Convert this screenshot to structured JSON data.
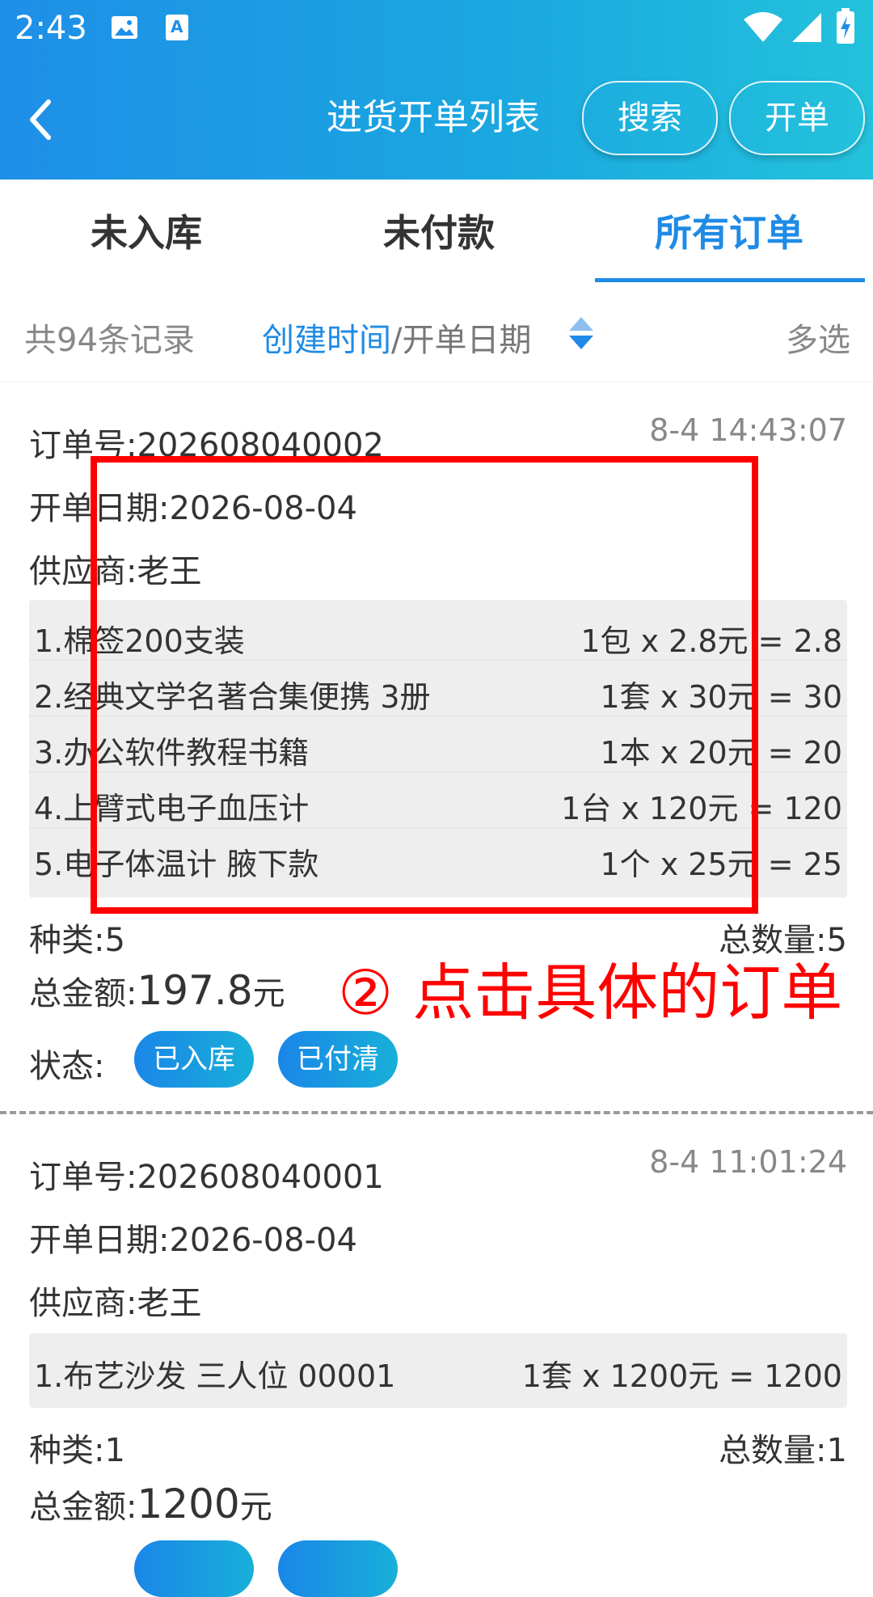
{
  "status_bar": {
    "time": "2:43",
    "icons": [
      "image-icon",
      "text-a-icon",
      "wifi-icon",
      "signal-icon",
      "battery-charging-icon"
    ]
  },
  "header": {
    "title": "进货开单列表",
    "search_label": "搜索",
    "create_label": "开单",
    "back_icon": "chevron-left-icon"
  },
  "tabs": [
    {
      "label": "未入库",
      "active": false
    },
    {
      "label": "未付款",
      "active": false
    },
    {
      "label": "所有订单",
      "active": true
    }
  ],
  "filter": {
    "record_count": "共94条记录",
    "sort_active": "创建时间",
    "sort_separator": "/",
    "sort_inactive": "开单日期",
    "multi_select": "多选"
  },
  "orders": [
    {
      "order_no_label": "订单号:",
      "order_no": "202608040002",
      "created_time": "8-4 14:43:07",
      "date_label": "开单日期:",
      "date": "2026-08-04",
      "supplier_label": "供应商:",
      "supplier": "老王",
      "items": [
        {
          "name": "1.棉签200支装",
          "calc": "1包 x 2.8元 = 2.8"
        },
        {
          "name": "2.经典文学名著合集便携 3册",
          "calc": "1套 x 30元 = 30"
        },
        {
          "name": "3.办公软件教程书籍",
          "calc": "1本 x 20元 = 20"
        },
        {
          "name": "4.上臂式电子血压计",
          "calc": "1台 x 120元 = 120"
        },
        {
          "name": "5.电子体温计 腋下款",
          "calc": "1个 x 25元 = 25"
        }
      ],
      "kinds_label": "种类:",
      "kinds": "5",
      "qty_label": "总数量:",
      "qty": "5",
      "total_label": "总金额:",
      "total_amount": "197.8",
      "total_unit": "元",
      "status_label": "状态:",
      "badges": [
        "已入库",
        "已付清"
      ]
    },
    {
      "order_no_label": "订单号:",
      "order_no": "202608040001",
      "created_time": "8-4 11:01:24",
      "date_label": "开单日期:",
      "date": "2026-08-04",
      "supplier_label": "供应商:",
      "supplier": "老王",
      "items": [
        {
          "name": "1.布艺沙发 三人位 00001",
          "calc": "1套 x 1200元 = 1200"
        }
      ],
      "kinds_label": "种类:",
      "kinds": "1",
      "qty_label": "总数量:",
      "qty": "1",
      "total_label": "总金额:",
      "total_amount": "1200",
      "total_unit": "元"
    }
  ],
  "annotation": {
    "text": "② 点击具体的订单",
    "color": "#ff0000"
  },
  "colors": {
    "accent": "#1f8be6",
    "header_gradient_start": "#1e8fe8",
    "header_gradient_end": "#23c2dc"
  }
}
